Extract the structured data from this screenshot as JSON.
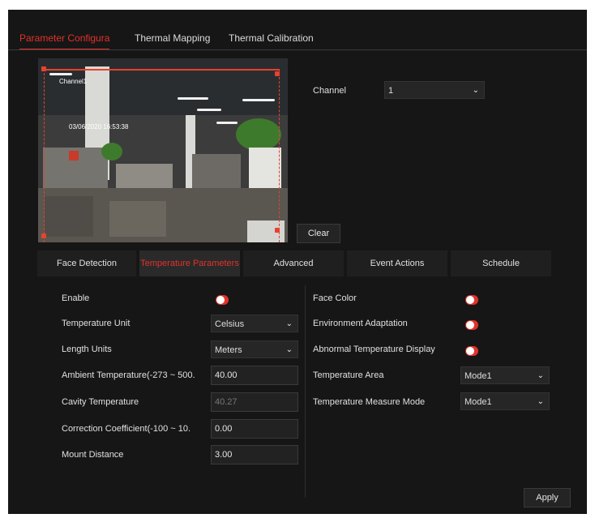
{
  "tabs": [
    {
      "label": "Parameter Configura",
      "active": true
    },
    {
      "label": "Thermal Mapping",
      "active": false
    },
    {
      "label": "Thermal Calibration",
      "active": false
    }
  ],
  "preview": {
    "osd_channel": "Channel1",
    "osd_datetime": "03/06/2020 16:53:38"
  },
  "channel": {
    "label": "Channel",
    "value": "1"
  },
  "clear_button": "Clear",
  "subtabs": [
    {
      "label": "Face Detection",
      "active": false
    },
    {
      "label": "Temperature Parameters",
      "active": true
    },
    {
      "label": "Advanced",
      "active": false
    },
    {
      "label": "Event Actions",
      "active": false
    },
    {
      "label": "Schedule",
      "active": false
    }
  ],
  "left_params": {
    "enable": {
      "label": "Enable",
      "on": true
    },
    "temperature_unit": {
      "label": "Temperature Unit",
      "value": "Celsius"
    },
    "length_units": {
      "label": "Length Units",
      "value": "Meters"
    },
    "ambient_temperature": {
      "label": "Ambient Temperature(-273 ~ 500.",
      "value": "40.00"
    },
    "cavity_temperature": {
      "label": "Cavity Temperature",
      "value": "40.27"
    },
    "correction_coefficient": {
      "label": "Correction Coefficient(-100 ~ 10.",
      "value": "0.00"
    },
    "mount_distance": {
      "label": "Mount Distance",
      "value": "3.00"
    }
  },
  "right_params": {
    "face_color": {
      "label": "Face Color",
      "on": true
    },
    "environment_adaptation": {
      "label": "Environment Adaptation",
      "on": true
    },
    "abnormal_temperature_display": {
      "label": "Abnormal Temperature Display",
      "on": true
    },
    "temperature_area": {
      "label": "Temperature Area",
      "value": "Mode1"
    },
    "temperature_measure_mode": {
      "label": "Temperature Measure Mode",
      "value": "Mode1"
    }
  },
  "apply_button": "Apply",
  "colors": {
    "accent": "#e2322b",
    "background": "#161616"
  },
  "icons": {
    "dropdown": "chevron-down-icon",
    "toggle": "toggle-switch-icon"
  }
}
